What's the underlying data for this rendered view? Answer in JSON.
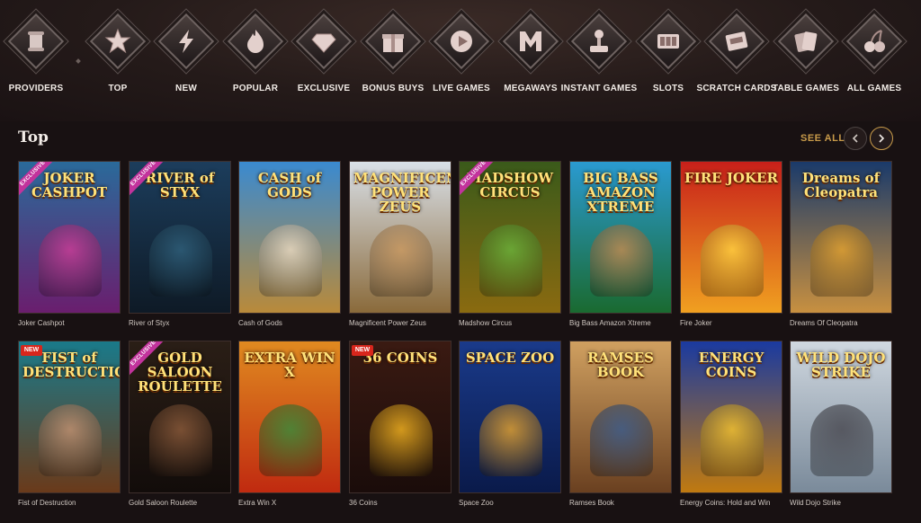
{
  "categories": [
    {
      "label": "PROVIDERS",
      "icon": "scroll-icon"
    },
    {
      "label": "TOP",
      "icon": "star-icon"
    },
    {
      "label": "NEW",
      "icon": "lightning-icon"
    },
    {
      "label": "POPULAR",
      "icon": "fire-icon"
    },
    {
      "label": "EXCLUSIVE",
      "icon": "diamond-icon"
    },
    {
      "label": "BONUS BUYS",
      "icon": "gift-icon"
    },
    {
      "label": "LIVE GAMES",
      "icon": "play-icon"
    },
    {
      "label": "MEGAWAYS",
      "icon": "m-logo-icon"
    },
    {
      "label": "INSTANT GAMES",
      "icon": "joystick-icon"
    },
    {
      "label": "SLOTS",
      "icon": "slot-machine-icon"
    },
    {
      "label": "SCRATCH CARDS",
      "icon": "scratch-card-icon"
    },
    {
      "label": "TABLE GAMES",
      "icon": "cards-icon"
    },
    {
      "label": "ALL GAMES",
      "icon": "cherry-icon"
    }
  ],
  "section": {
    "title": "Top",
    "see_all": "SEE ALL",
    "prev_icon": "chevron-left-icon",
    "next_icon": "chevron-right-icon"
  },
  "games": [
    {
      "name": "Joker Cashpot",
      "title": "JOKER CASHPOT",
      "badge": "EXCLUSIVE",
      "bg1": "#2a6a9a",
      "bg2": "#6a1e6e",
      "art": "#c93d96"
    },
    {
      "name": "River of Styx",
      "title": "RIVER of STYX",
      "badge": "EXCLUSIVE",
      "bg1": "#1c3d5c",
      "bg2": "#0e1a26",
      "art": "#2f5f7a"
    },
    {
      "name": "Cash of Gods",
      "title": "CASH of GODS",
      "badge": "",
      "bg1": "#3a8ad0",
      "bg2": "#b98a3a",
      "art": "#e8d8c0"
    },
    {
      "name": "Magnificent Power Zeus",
      "title": "MAGNIFICENT POWER ZEUS",
      "badge": "",
      "bg1": "#d9e0e8",
      "bg2": "#8a6a3a",
      "art": "#c89860"
    },
    {
      "name": "Madshow Circus",
      "title": "MADSHOW CIRCUS",
      "badge": "EXCLUSIVE",
      "bg1": "#3a5a1a",
      "bg2": "#8a6a10",
      "art": "#6ab03a"
    },
    {
      "name": "Big Bass Amazon Xtreme",
      "title": "BIG BASS AMAZON XTREME",
      "badge": "",
      "bg1": "#2a9ad0",
      "bg2": "#1a6a30",
      "art": "#c08a50"
    },
    {
      "name": "Fire Joker",
      "title": "FIRE JOKER",
      "badge": "",
      "bg1": "#c8201a",
      "bg2": "#f0a020",
      "art": "#ffd040"
    },
    {
      "name": "Dreams Of Cleopatra",
      "title": "Dreams of Cleopatra",
      "badge": "",
      "bg1": "#1a3a6a",
      "bg2": "#c89040",
      "art": "#e0a030"
    },
    {
      "name": "Fist of Destruction",
      "title": "FIST of DESTRUCTION",
      "badge": "NEW",
      "bg1": "#1a7a8a",
      "bg2": "#6a3a1a",
      "art": "#c09070"
    },
    {
      "name": "Gold Saloon Roulette",
      "title": "GOLD SALOON ROULETTE",
      "badge": "EXCLUSIVE",
      "bg1": "#2a1e16",
      "bg2": "#120c0a",
      "art": "#8a5a3a"
    },
    {
      "name": "Extra Win X",
      "title": "EXTRA WIN X",
      "badge": "",
      "bg1": "#e08a20",
      "bg2": "#c02a10",
      "art": "#3a8a3a"
    },
    {
      "name": "36 Coins",
      "title": "36 COINS",
      "badge": "NEW",
      "bg1": "#3a1a12",
      "bg2": "#1a0c0a",
      "art": "#f0b020"
    },
    {
      "name": "Space Zoo",
      "title": "SPACE ZOO",
      "badge": "",
      "bg1": "#1a3a8a",
      "bg2": "#0a1a4a",
      "art": "#e0a030"
    },
    {
      "name": "Ramses Book",
      "title": "RAMSES BOOK",
      "badge": "",
      "bg1": "#d0a060",
      "bg2": "#6a4020",
      "art": "#3a5a8a"
    },
    {
      "name": "Energy Coins: Hold and Win",
      "title": "ENERGY COINS",
      "badge": "",
      "bg1": "#1a3aa0",
      "bg2": "#c07a10",
      "art": "#f0c030"
    },
    {
      "name": "Wild Dojo Strike",
      "title": "WILD DOJO STRIKE",
      "badge": "",
      "bg1": "#d0d8e0",
      "bg2": "#7a8a9a",
      "art": "#4a4a52"
    }
  ]
}
